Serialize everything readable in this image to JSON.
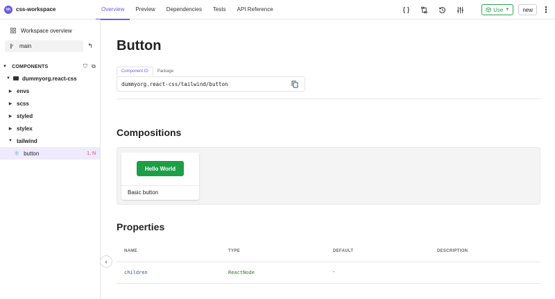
{
  "workspace": {
    "initials": "bh",
    "name": "css-workspace"
  },
  "nav": {
    "tabs": [
      {
        "label": "Overview",
        "active": true
      },
      {
        "label": "Preview"
      },
      {
        "label": "Dependencies"
      },
      {
        "label": "Tests"
      },
      {
        "label": "API Reference"
      }
    ]
  },
  "toolbar": {
    "icons": [
      "code-icon",
      "compare-icon",
      "history-icon",
      "sliders-icon"
    ],
    "use_label": "Use",
    "new_label": "new"
  },
  "sidebar": {
    "overview_label": "Workspace overview",
    "lane": "main",
    "components_header": "COMPONENTS",
    "scope": "dummyorg.react-css",
    "namespaces": [
      "envs",
      "scss",
      "styled",
      "stylex",
      "tailwind"
    ],
    "selected_component": {
      "name": "button",
      "badge": "1, N"
    }
  },
  "main": {
    "title": "Button",
    "id_tabs": [
      "Component ID",
      "Package"
    ],
    "component_id": "dummyorg.react-css/tailwind/button",
    "compositions_title": "Compositions",
    "composition": {
      "preview_button": "Hello World",
      "label": "Basic button"
    },
    "properties_title": "Properties",
    "properties": {
      "columns": [
        "NAME",
        "TYPE",
        "DEFAULT",
        "DESCRIPTION"
      ],
      "rows": [
        {
          "name": "children",
          "type": "ReactNode",
          "default": "-",
          "description": ""
        }
      ]
    }
  },
  "colors": {
    "accent": "#6c5ce7",
    "use_green": "#2ea44f",
    "preview_green": "#1e9e46",
    "badge_red": "#e0445c"
  }
}
